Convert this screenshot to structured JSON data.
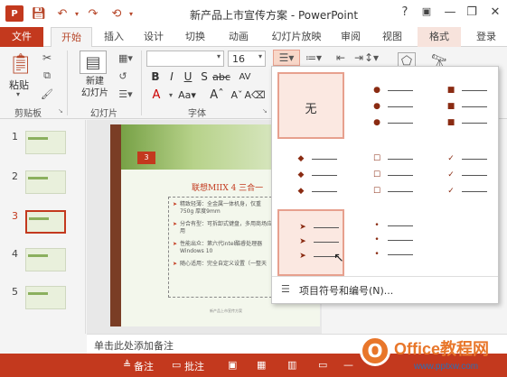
{
  "window": {
    "title": "新产品上市宣传方案 - PowerPoint",
    "help": "?",
    "minimize": "—",
    "restore": "❐",
    "close": "✕"
  },
  "tabs": {
    "file": "文件",
    "home": "开始",
    "insert": "插入",
    "design": "设计",
    "transitions": "切换",
    "animations": "动画",
    "slideshow": "幻灯片放映",
    "review": "审阅",
    "view": "视图",
    "format": "格式",
    "login": "登录"
  },
  "ribbon": {
    "paste": "粘贴",
    "new_slide": "新建\n幻灯片",
    "new_slide_l1": "新建",
    "new_slide_l2": "幻灯片",
    "font_size": "16",
    "groups": {
      "clipboard": "剪贴板",
      "slides": "幻灯片",
      "font": "字体"
    }
  },
  "thumbnails": [
    "1",
    "2",
    "3",
    "4",
    "5"
  ],
  "selected_slide": "3",
  "slide": {
    "number": "3",
    "title": "联想MIIX 4 三合一",
    "bullets": [
      "精致轻薄：全金属一体机身，仅重750g 厚度9mm",
      "分合有型：可拆卸式键盘，多用商场应用",
      "性能出众：第六代intel酷睿处理器Windows 10",
      "随心适用：完全自定义设置（一整天"
    ],
    "footer": "新产品上市宣传方案"
  },
  "notes": {
    "placeholder": "单击此处添加备注"
  },
  "status": {
    "notes": "备注",
    "comments": "批注"
  },
  "bullets_dropdown": {
    "none_label": "无",
    "footer_label": "项目符号和编号(N)...",
    "styles": [
      {
        "name": "none"
      },
      {
        "name": "filled-round",
        "glyph": "●"
      },
      {
        "name": "filled-square",
        "glyph": "■"
      },
      {
        "name": "diamond",
        "glyph": "◆"
      },
      {
        "name": "hollow-square",
        "glyph": "☐"
      },
      {
        "name": "checkmark",
        "glyph": "✓"
      },
      {
        "name": "arrow",
        "glyph": "➤"
      },
      {
        "name": "small-dot",
        "glyph": "•"
      }
    ]
  },
  "watermark": {
    "brand": "Office教程网",
    "url": "www.pptxw.com"
  },
  "colors": {
    "accent": "#c3391e",
    "selected_cell": "#fbe8e1"
  }
}
